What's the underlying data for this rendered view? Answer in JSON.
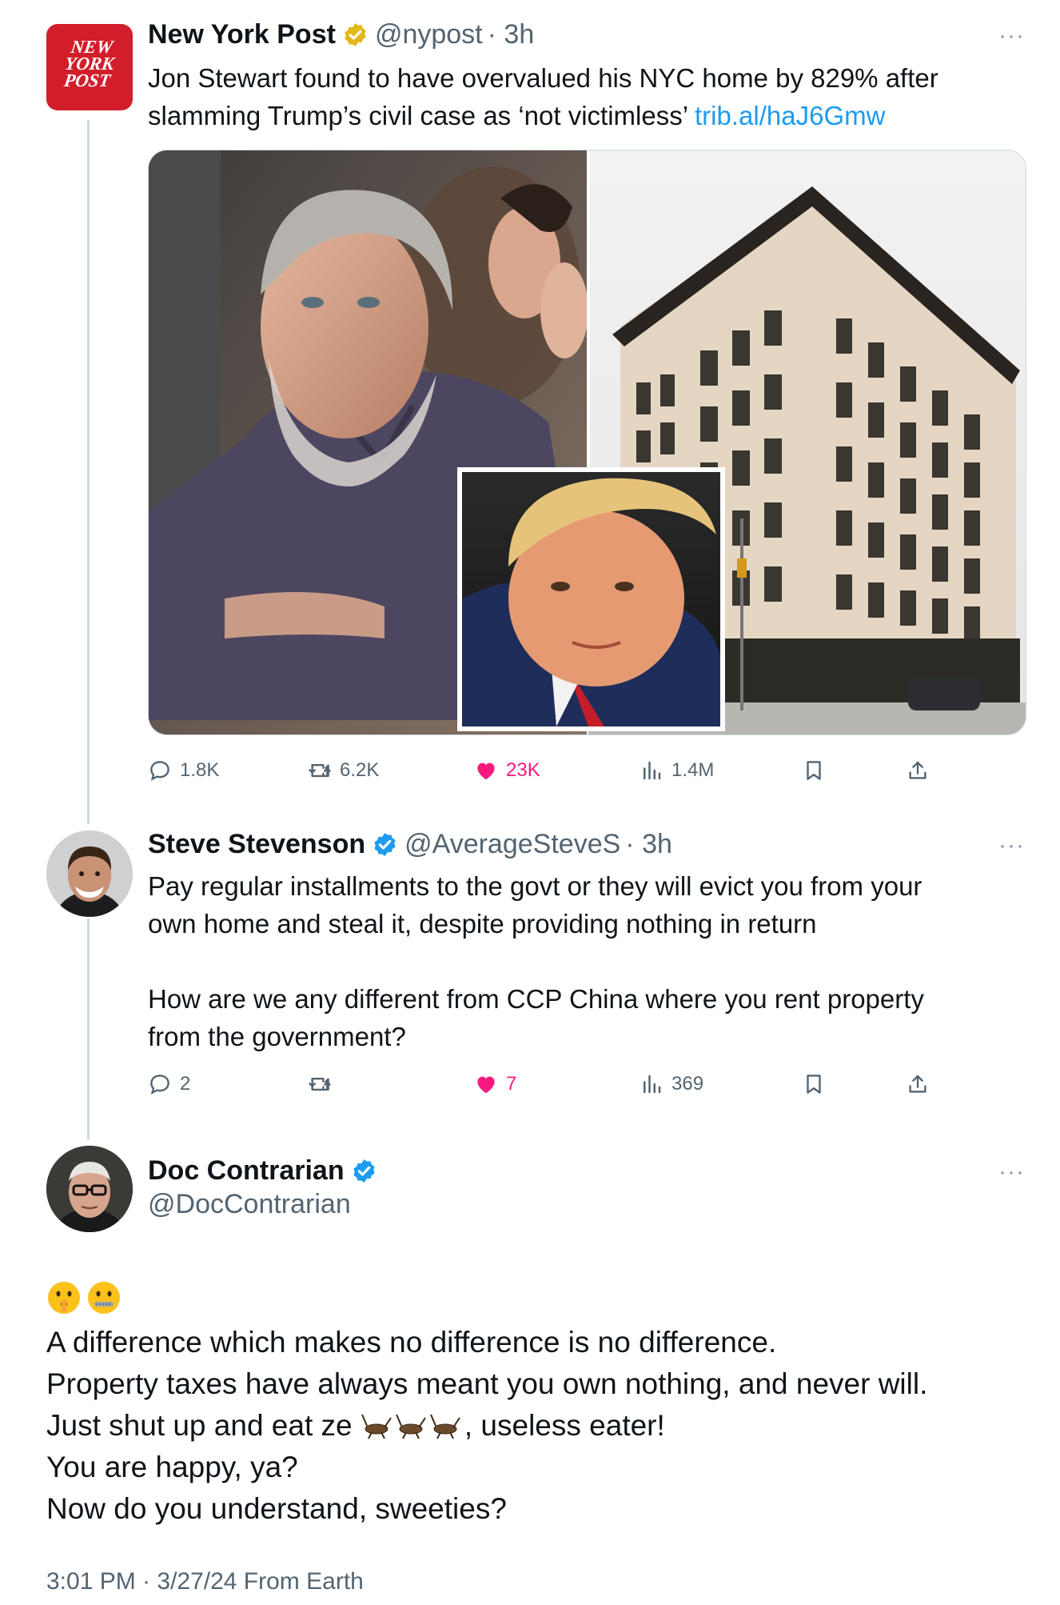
{
  "tweet1": {
    "name": "New York Post",
    "handle": "@nypost",
    "time": "· 3h",
    "logo_text": [
      "NEW",
      "YORK",
      "POST"
    ],
    "text_line1": "Jon Stewart found to have overvalued his NYC home by 829% after",
    "text_line2": "slamming Trump’s civil case as ‘not victimless’ ",
    "link": "trib.al/haJ6Gmw",
    "replies": "1.8K",
    "reposts": "6.2K",
    "likes": "23K",
    "views": "1.4M",
    "more": "···"
  },
  "tweet2": {
    "name": "Steve Stevenson",
    "handle": "@AverageSteveS",
    "time": "· 3h",
    "text_line1": "Pay regular installments to the govt or they will evict you from your",
    "text_line2": "own home and steal it, despite providing nothing in return",
    "text_line3": "How are we any different from CCP China where you rent property",
    "text_line4": "from the government?",
    "replies": "2",
    "reposts": "",
    "likes": "7",
    "views": "369",
    "more": "···"
  },
  "tweet3": {
    "name": "Doc Contrarian",
    "handle": "@DocContrarian",
    "emoji": "🤫🤐",
    "line1": "A difference which makes no difference is no difference.",
    "line2": "Property taxes have always meant you own nothing, and never will.",
    "line3a": "Just shut up and eat ze ",
    "line3b": ", useless eater!",
    "line4": "You are happy, ya?",
    "line5": "Now do you understand, sweeties?",
    "footer": "3:01 PM · 3/27/24 From Earth",
    "more": "···"
  },
  "colors": {
    "accent": "#1d9bf0",
    "like": "#f91880",
    "muted": "#536471",
    "verified_gold": "#e2b719",
    "nypost_red": "#d21e2b"
  }
}
